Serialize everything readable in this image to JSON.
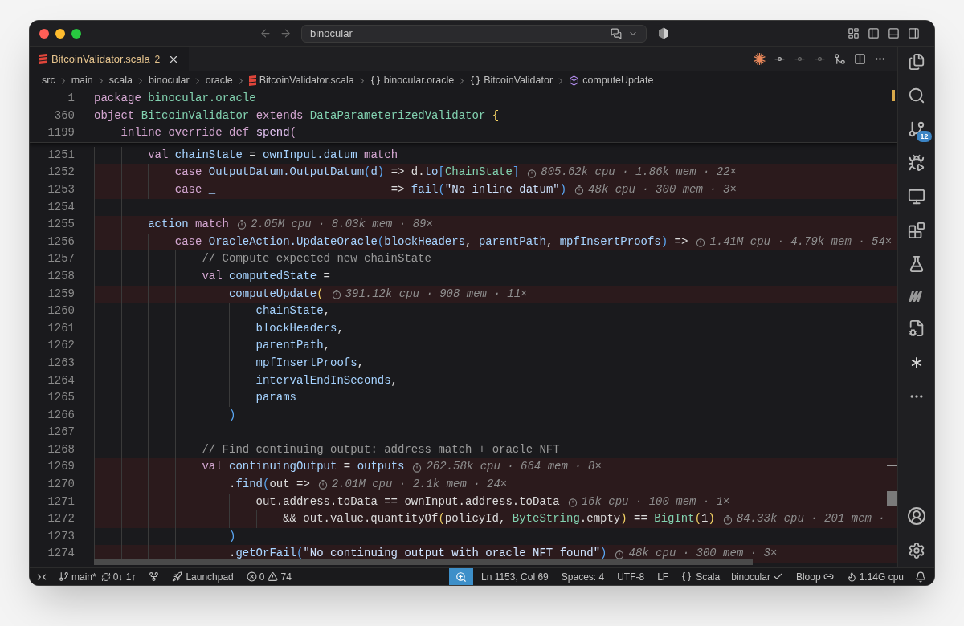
{
  "window": {
    "search": "binocular"
  },
  "tab": {
    "label": "BitcoinValidator.scala",
    "problems": "2",
    "selected": true
  },
  "breadcrumbs": [
    {
      "label": "src",
      "kind": "folder"
    },
    {
      "label": "main",
      "kind": "folder"
    },
    {
      "label": "scala",
      "kind": "folder"
    },
    {
      "label": "binocular",
      "kind": "folder"
    },
    {
      "label": "oracle",
      "kind": "folder"
    },
    {
      "label": "BitcoinValidator.scala",
      "kind": "file"
    },
    {
      "label": "binocular.oracle",
      "kind": "namespace"
    },
    {
      "label": "BitcoinValidator",
      "kind": "namespace"
    },
    {
      "label": "computeUpdate",
      "kind": "method"
    }
  ],
  "sticky_lines": [
    {
      "number": "1",
      "tokens": [
        {
          "text": "package ",
          "kind": "kw"
        },
        {
          "text": "binocular.oracle",
          "kind": "type"
        }
      ]
    },
    {
      "number": "360",
      "tokens": [
        {
          "text": "object ",
          "kind": "kw"
        },
        {
          "text": "BitcoinValidator",
          "kind": "type"
        },
        {
          "text": " extends ",
          "kind": "kw"
        },
        {
          "text": "DataParameterizedValidator",
          "kind": "type"
        },
        {
          "text": " {",
          "kind": "yellow"
        }
      ]
    },
    {
      "number": "1199",
      "tokens": [
        {
          "text": "    inline override def ",
          "kind": "kw"
        },
        {
          "text": "spend",
          "kind": "method"
        },
        {
          "text": "(",
          "kind": "kw"
        }
      ]
    }
  ],
  "lines": [
    {
      "number": "1251",
      "highlighted": false,
      "tokens": [
        {
          "text": "        val ",
          "kind": "kw"
        },
        {
          "text": "chainState",
          "kind": "var"
        },
        {
          "text": " = ",
          "kind": "plain"
        },
        {
          "text": "ownInput.datum",
          "kind": "var"
        },
        {
          "text": " match",
          "kind": "kw"
        }
      ]
    },
    {
      "number": "1252",
      "highlighted": true,
      "tokens": [
        {
          "text": "            case ",
          "kind": "kw"
        },
        {
          "text": "OutputDatum.OutputDatum",
          "kind": "var"
        },
        {
          "text": "(",
          "kind": "blue"
        },
        {
          "text": "d",
          "kind": "var"
        },
        {
          "text": ")",
          "kind": "blue"
        },
        {
          "text": " => d.",
          "kind": "plain"
        },
        {
          "text": "to",
          "kind": "var"
        },
        {
          "text": "[",
          "kind": "blue"
        },
        {
          "text": "ChainState",
          "kind": "type"
        },
        {
          "text": "]",
          "kind": "blue"
        }
      ],
      "hint": "805.62k cpu · 1.86k mem · 22×"
    },
    {
      "number": "1253",
      "highlighted": true,
      "tokens": [
        {
          "text": "            case ",
          "kind": "kw"
        },
        {
          "text": "_",
          "kind": "var"
        },
        {
          "text": "                          => ",
          "kind": "plain"
        },
        {
          "text": "fail",
          "kind": "var"
        },
        {
          "text": "(",
          "kind": "blue"
        },
        {
          "text": "\"No inline datum\"",
          "kind": "str"
        },
        {
          "text": ")",
          "kind": "blue"
        }
      ],
      "hint": "48k cpu · 300 mem · 3×"
    },
    {
      "number": "1254",
      "highlighted": false
    },
    {
      "number": "1255",
      "highlighted": true,
      "tokens": [
        {
          "text": "        action",
          "kind": "var"
        },
        {
          "text": " match",
          "kind": "kw"
        }
      ],
      "hint": "2.05M cpu · 8.03k mem · 89×"
    },
    {
      "number": "1256",
      "highlighted": true,
      "tokens": [
        {
          "text": "            case ",
          "kind": "kw"
        },
        {
          "text": "OracleAction.UpdateOracle",
          "kind": "var"
        },
        {
          "text": "(",
          "kind": "blue"
        },
        {
          "text": "blockHeaders",
          "kind": "var"
        },
        {
          "text": ", ",
          "kind": "plain"
        },
        {
          "text": "parentPath",
          "kind": "var"
        },
        {
          "text": ", ",
          "kind": "plain"
        },
        {
          "text": "mpfInsertProofs",
          "kind": "var"
        },
        {
          "text": ")",
          "kind": "blue"
        },
        {
          "text": " =>",
          "kind": "plain"
        }
      ],
      "hint": "1.41M cpu · 4.79k mem · 54×"
    },
    {
      "number": "1257",
      "highlighted": false,
      "tokens": [
        {
          "text": "                // Compute expected new chainState",
          "kind": "comment"
        }
      ]
    },
    {
      "number": "1258",
      "highlighted": false,
      "tokens": [
        {
          "text": "                val ",
          "kind": "kw"
        },
        {
          "text": "computedState",
          "kind": "var"
        },
        {
          "text": " =",
          "kind": "plain"
        }
      ]
    },
    {
      "number": "1259",
      "highlighted": true,
      "tokens": [
        {
          "text": "                    computeUpdate",
          "kind": "var"
        },
        {
          "text": "(",
          "kind": "yellow"
        }
      ],
      "hint": "391.12k cpu · 908 mem · 11×"
    },
    {
      "number": "1260",
      "highlighted": false,
      "tokens": [
        {
          "text": "                        chainState",
          "kind": "var"
        },
        {
          "text": ",",
          "kind": "plain"
        }
      ]
    },
    {
      "number": "1261",
      "highlighted": false,
      "tokens": [
        {
          "text": "                        blockHeaders",
          "kind": "var"
        },
        {
          "text": ",",
          "kind": "plain"
        }
      ]
    },
    {
      "number": "1262",
      "highlighted": false,
      "tokens": [
        {
          "text": "                        parentPath",
          "kind": "var"
        },
        {
          "text": ",",
          "kind": "plain"
        }
      ]
    },
    {
      "number": "1263",
      "highlighted": false,
      "tokens": [
        {
          "text": "                        mpfInsertProofs",
          "kind": "var"
        },
        {
          "text": ",",
          "kind": "plain"
        }
      ]
    },
    {
      "number": "1264",
      "highlighted": false,
      "tokens": [
        {
          "text": "                        intervalEndInSeconds",
          "kind": "var"
        },
        {
          "text": ",",
          "kind": "plain"
        }
      ]
    },
    {
      "number": "1265",
      "highlighted": false,
      "tokens": [
        {
          "text": "                        params",
          "kind": "var"
        }
      ]
    },
    {
      "number": "1266",
      "highlighted": false,
      "tokens": [
        {
          "text": "                    )",
          "kind": "blue"
        }
      ]
    },
    {
      "number": "1267",
      "highlighted": false
    },
    {
      "number": "1268",
      "highlighted": false,
      "tokens": [
        {
          "text": "                // Find continuing output: address match + oracle NFT",
          "kind": "comment"
        }
      ]
    },
    {
      "number": "1269",
      "highlighted": true,
      "tokens": [
        {
          "text": "                val ",
          "kind": "kw"
        },
        {
          "text": "continuingOutput",
          "kind": "var"
        },
        {
          "text": " = ",
          "kind": "plain"
        },
        {
          "text": "outputs",
          "kind": "var"
        }
      ],
      "hint": "262.58k cpu · 664 mem · 8×"
    },
    {
      "number": "1270",
      "highlighted": true,
      "tokens": [
        {
          "text": "                    .",
          "kind": "plain"
        },
        {
          "text": "find",
          "kind": "var"
        },
        {
          "text": "(",
          "kind": "blue"
        },
        {
          "text": "out =>",
          "kind": "plain"
        }
      ],
      "hint": "2.01M cpu · 2.1k mem · 24×"
    },
    {
      "number": "1271",
      "highlighted": true,
      "tokens": [
        {
          "text": "                        out.address.toData == ownInput.address.toData",
          "kind": "plain"
        }
      ],
      "hint": "16k cpu · 100 mem · 1×"
    },
    {
      "number": "1272",
      "highlighted": true,
      "tokens": [
        {
          "text": "                            && out.value.quantityOf",
          "kind": "plain"
        },
        {
          "text": "(",
          "kind": "yellow"
        },
        {
          "text": "policyId, ",
          "kind": "plain"
        },
        {
          "text": "ByteString",
          "kind": "type"
        },
        {
          "text": ".empty",
          "kind": "plain"
        },
        {
          "text": ")",
          "kind": "yellow"
        },
        {
          "text": " == ",
          "kind": "plain"
        },
        {
          "text": "BigInt",
          "kind": "type"
        },
        {
          "text": "(",
          "kind": "yellow"
        },
        {
          "text": "1",
          "kind": "plain"
        },
        {
          "text": ")",
          "kind": "yellow"
        }
      ],
      "hint": "84.33k cpu · 201 mem ·"
    },
    {
      "number": "1273",
      "highlighted": false,
      "tokens": [
        {
          "text": "                    )",
          "kind": "blue"
        }
      ]
    },
    {
      "number": "1274",
      "highlighted": true,
      "tokens": [
        {
          "text": "                    .",
          "kind": "plain"
        },
        {
          "text": "getOrFail",
          "kind": "var"
        },
        {
          "text": "(",
          "kind": "blue"
        },
        {
          "text": "\"No continuing output with oracle NFT found\"",
          "kind": "str"
        },
        {
          "text": ")",
          "kind": "blue"
        }
      ],
      "hint": "48k cpu · 300 mem · 3×"
    }
  ],
  "activity_bar": {
    "source_control_badge": "12"
  },
  "status_bar": {
    "branch": "main*",
    "sync": "0↓ 1↑",
    "launchpad": "Launchpad",
    "errors": "0",
    "warnings": "74",
    "position": "Ln 1153, Col 69",
    "spaces": "Spaces: 4",
    "encoding": "UTF-8",
    "eol": "LF",
    "language": "Scala",
    "build": "binocular",
    "server": "Bloop",
    "cpu": "1.14G cpu"
  }
}
